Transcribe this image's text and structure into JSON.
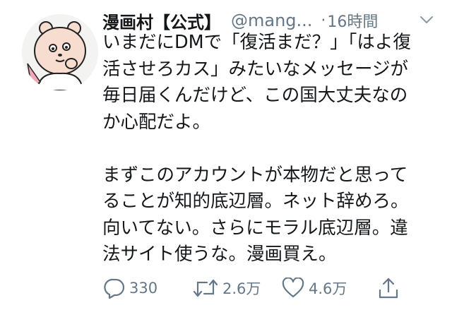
{
  "tweet": {
    "display_name": "漫画村【公式】",
    "handle": "@mang...",
    "separator": "·",
    "time": "16時間",
    "lines_para1": [
      "いまだにDMで「復活まだ？」「はよ復",
      "活させろカス」みたいなメッセージが",
      "毎日届くんだけど、この国大丈夫なの",
      "か心配だよ。"
    ],
    "lines_para2": [
      "まずこのアカウントが本物だと思って",
      "ることが知的底辺層。ネット辞めろ。",
      "向いてない。さらにモラル底辺層。違",
      "法サイト使うな。漫画買え。"
    ]
  },
  "actions": {
    "reply_count": "330",
    "retweet_count": "2.6万",
    "like_count": "4.6万"
  },
  "icons": {
    "avatar": "bear-character-avatar",
    "caret": "chevron-down-icon",
    "reply": "reply-icon",
    "retweet": "retweet-icon",
    "like": "heart-icon",
    "share": "share-icon"
  },
  "colors": {
    "text": "#14171a",
    "secondary": "#657786",
    "background": "#ffffff"
  }
}
